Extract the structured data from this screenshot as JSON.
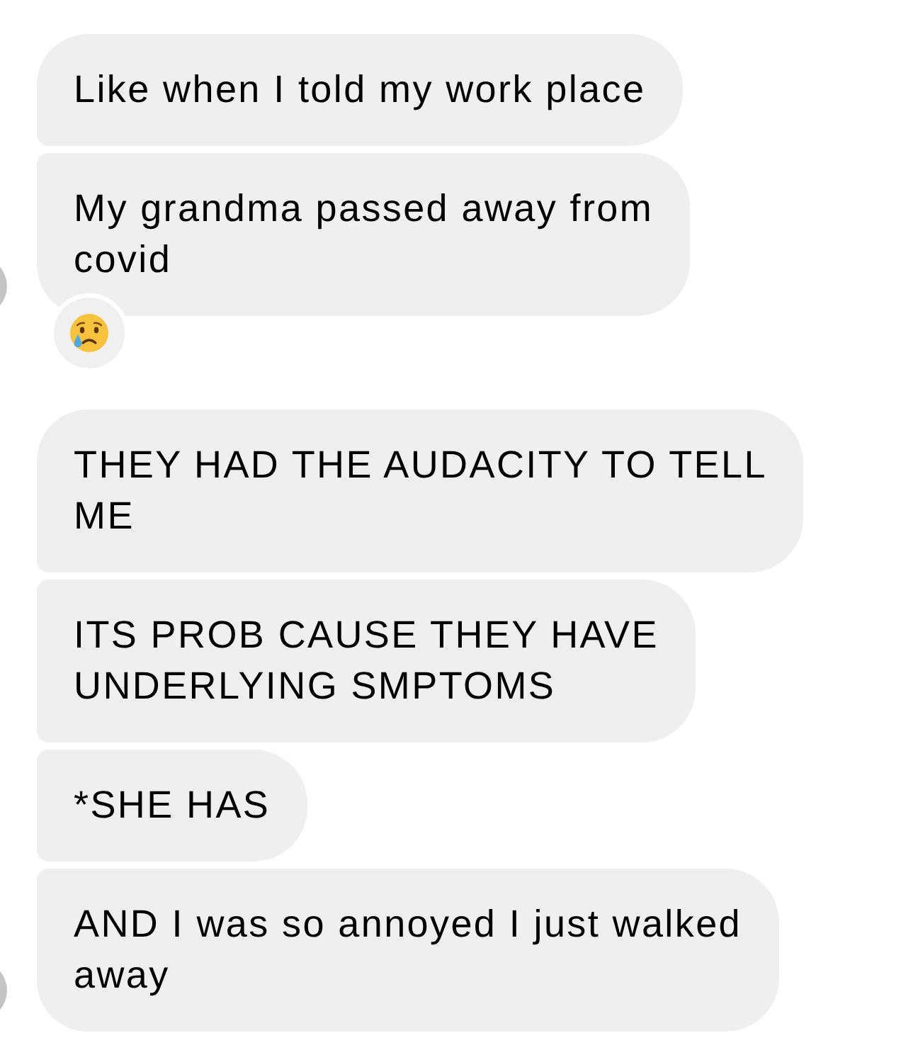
{
  "groups": [
    {
      "messages": [
        {
          "lines": [
            "Like when I told my work place"
          ],
          "reacted": false
        },
        {
          "lines": [
            "My grandma passed away from",
            "covid"
          ],
          "reacted": true
        }
      ]
    },
    {
      "messages": [
        {
          "lines": [
            "THEY HAD THE AUDACITY TO TELL",
            "ME"
          ],
          "reacted": false
        },
        {
          "lines": [
            "ITS PROB CAUSE THEY HAVE",
            "UNDERLYING SMPTOMS"
          ],
          "reacted": false
        },
        {
          "lines": [
            "*SHE HAS"
          ],
          "reacted": false
        },
        {
          "lines": [
            "AND I was so annoyed I just walked",
            "away"
          ],
          "reacted": false
        }
      ]
    }
  ]
}
